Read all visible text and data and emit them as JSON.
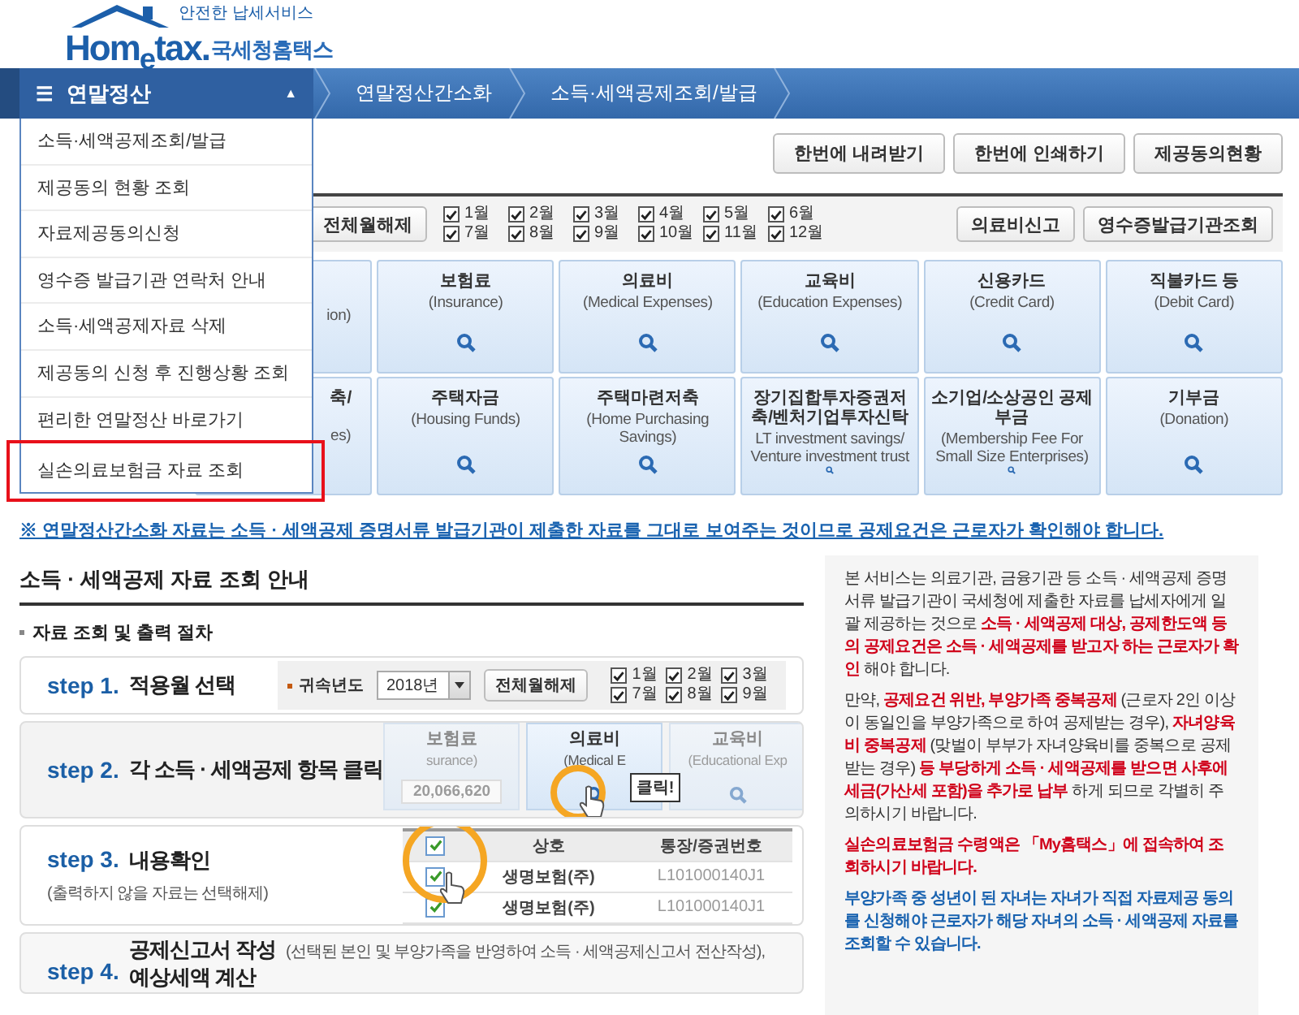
{
  "logo": {
    "tagline": "안전한 납세서비스",
    "brand": "Hom$_{e}$tax.",
    "brand_kr": "국세청홈택스"
  },
  "nav": {
    "menu_icon": "☰",
    "menu_label": "연말정산",
    "caret": "▲",
    "breadcrumbs": [
      "연말정산간소화",
      "소득·세액공제조회/발급"
    ]
  },
  "menu": {
    "items": [
      {
        "label": "소득·세액공제조회/발급",
        "highlighted": false
      },
      {
        "label": "제공동의 현황 조회",
        "highlighted": false
      },
      {
        "label": "자료제공동의신청",
        "highlighted": false
      },
      {
        "label": "영수증 발급기관 연락처 안내",
        "highlighted": false
      },
      {
        "label": "소득·세액공제자료 삭제",
        "highlighted": false
      },
      {
        "label": "제공동의 신청 후 진행상황 조회",
        "highlighted": false
      },
      {
        "label": "편리한 연말정산 바로가기",
        "highlighted": false
      },
      {
        "label": "실손의료보험금 자료 조회",
        "highlighted": true
      }
    ]
  },
  "toolbar": {
    "buttons": [
      "한번에 내려받기",
      "한번에 인쇄하기",
      "제공동의현황"
    ]
  },
  "month_filter": {
    "clear_button": "전체월해제",
    "months": [
      {
        "label": "1월",
        "checked": true
      },
      {
        "label": "2월",
        "checked": true
      },
      {
        "label": "3월",
        "checked": true
      },
      {
        "label": "4월",
        "checked": true
      },
      {
        "label": "5월",
        "checked": true
      },
      {
        "label": "6월",
        "checked": true
      },
      {
        "label": "7월",
        "checked": true
      },
      {
        "label": "8월",
        "checked": true
      },
      {
        "label": "9월",
        "checked": true
      },
      {
        "label": "10월",
        "checked": true
      },
      {
        "label": "11월",
        "checked": true
      },
      {
        "label": "12월",
        "checked": true
      }
    ],
    "buttons": [
      "의료비신고",
      "영수증발급기관조회"
    ]
  },
  "tiles": [
    {
      "kind": "cut",
      "subtitle": "ion)"
    },
    {
      "kind": "full",
      "title": "보험료",
      "subtitle": "(Insurance)"
    },
    {
      "kind": "full",
      "title": "의료비",
      "subtitle": "(Medical Expenses)"
    },
    {
      "kind": "full",
      "title": "교육비",
      "subtitle": "(Education Expenses)"
    },
    {
      "kind": "full",
      "title": "신용카드",
      "subtitle": "(Credit Card)"
    },
    {
      "kind": "full",
      "title": "직불카드 등",
      "subtitle": "(Debit Card)"
    },
    {
      "kind": "cut",
      "title": "축/",
      "subtitle": "es)"
    },
    {
      "kind": "full",
      "title": "주택자금",
      "subtitle": "(Housing Funds)"
    },
    {
      "kind": "full",
      "title": "주택마련저축",
      "subtitle": "(Home Purchasing Savings)"
    },
    {
      "kind": "full",
      "title": "장기집합투자증권저축/벤처기업투자신탁",
      "subtitle": "LT investment savings/ Venture investment trust"
    },
    {
      "kind": "full",
      "title": "소기업/소상공인 공제부금",
      "subtitle": "(Membership Fee For Small Size Enterprises)"
    },
    {
      "kind": "full",
      "title": "기부금",
      "subtitle": "(Donation)"
    }
  ],
  "notice": "※ 연말정산간소화 자료는 소득 · 세액공제 증명서류 발급기관이 제출한 자료를 그대로 보여주는 것이므로 공제요건은 근로자가 확인해야 합니다.",
  "guide": {
    "title": "소득 · 세액공제 자료 조회 안내",
    "subtitle": "자료 조회 및 출력 절차",
    "steps": [
      {
        "kind": "months",
        "step": "step 1.",
        "title": "적용월 선택",
        "year_label": "귀속년도",
        "year": "2018년",
        "clear_button": "전체월해제",
        "months": [
          {
            "label": "1월",
            "checked": true
          },
          {
            "label": "2월",
            "checked": true
          },
          {
            "label": "3월",
            "checked": true
          },
          {
            "label": "7월",
            "checked": true
          },
          {
            "label": "8월",
            "checked": true
          },
          {
            "label": "9월",
            "checked": true
          }
        ]
      },
      {
        "kind": "tiles",
        "step": "step 2.",
        "title": "각 소득 · 세액공제 항목 클릭",
        "tiles": [
          {
            "title": "보험료",
            "subtitle": "surance)",
            "value": "20,066,620"
          },
          {
            "title": "의료비",
            "subtitle": "(Medical E",
            "callout": "클릭!"
          },
          {
            "title": "교육비",
            "subtitle": "(Educational Exp"
          }
        ]
      },
      {
        "kind": "table",
        "step": "step 3.",
        "title": "내용확인",
        "note": "(출력하지 않을 자료는 선택해제)",
        "header_checked": true,
        "columns": [
          "상호",
          "통장/증권번호"
        ],
        "rows": [
          {
            "checked": true,
            "cells": [
              "생명보험(주)",
              "L101000140J1"
            ]
          },
          {
            "checked": true,
            "cells": [
              "생명보험(주)",
              "L101000140J1"
            ]
          }
        ]
      },
      {
        "kind": "report",
        "step": "step 4.",
        "lines": [
          {
            "title": "공제신고서 작성",
            "note": "(선택된 본인 및 부양가족을 반영하여 소득 · 세액공제신고서 전산작성),"
          },
          {
            "title": "예상세액 계산"
          }
        ]
      }
    ]
  },
  "info": {
    "paragraphs": [
      {
        "kind": "plain",
        "text": "본 서비스는 의료기관, 금융기관 등 소득 · 세액공제 증명서류 발급기관이 국세청에 제출한 자료를 납세자에게 일괄 제공하는 것으로 **소득 · 세액공제 대상, 공제한도액 등의 공제요건은 소득 · 세액공제를 받고자 하는 근로자가 확인** 해야 합니다."
      },
      {
        "kind": "plain",
        "text": "만약, **공제요건 위반, 부양가족 중복공제** (근로자 2인 이상이 동일인을 부양가족으로 하여 공제받는 경우), **자녀양육비 중복공제** (맞벌이 부부가 자녀양육비를 중복으로 공제받는 경우) **등 부당하게 소득 · 세액공제를 받으면 사후에 세금(가산세 포함)을 추가로 납부** 하게 되므로 각별히 주의하시기 바랍니다."
      },
      {
        "kind": "warning",
        "text": "실손의료보험금 수령액은 「My홈택스」에 접속하여 조회하시기 바랍니다."
      },
      {
        "kind": "note",
        "text": "부양가족 중 성년이 된 자녀는 자녀가 직접 자료제공 동의를 신청해야 근로자가 해당 자녀의 소득 · 세액공제 자료를 조회할 수 있습니다."
      }
    ]
  }
}
